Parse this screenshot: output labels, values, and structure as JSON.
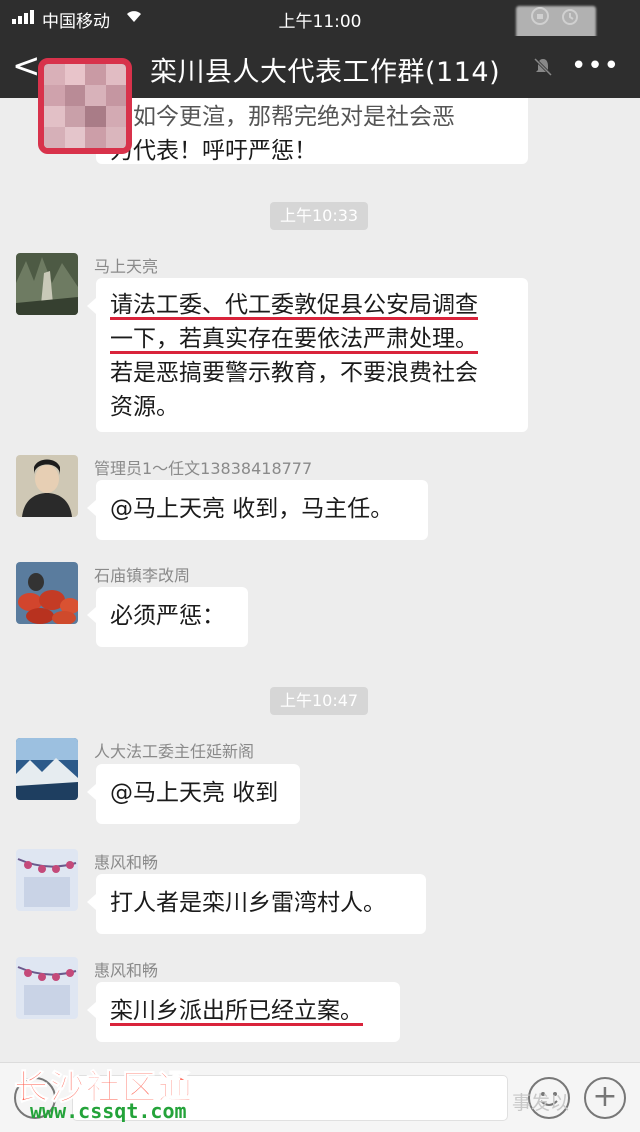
{
  "status_bar": {
    "carrier": "中国移动",
    "time": "上午11:00"
  },
  "nav": {
    "title": "栾川县人大代表工作群(114)"
  },
  "messages": {
    "m0": {
      "line1": "，如今更渲，那帮完绝对是社会恶",
      "line2": "力代表！呼吁严惩！"
    },
    "ts1": "上午10:33",
    "m1": {
      "sender": "马上天亮",
      "line1": "请法工委、代工委敦促县公安局调查",
      "line2": "一下，若真实存在要依法严肃处理。",
      "line3": "若是恶搞要警示教育，不要浪费社会",
      "line4": "资源。"
    },
    "m2": {
      "sender": "管理员1～任文13838418777",
      "text": "@马上天亮 收到，马主任。"
    },
    "m3": {
      "sender": "石庙镇李改周",
      "text": "必须严惩："
    },
    "ts2": "上午10:47",
    "m4": {
      "sender": "人大法工委主任延新阁",
      "text": "@马上天亮 收到"
    },
    "m5": {
      "sender": "惠风和畅",
      "text": "打人者是栾川乡雷湾村人。"
    },
    "m6": {
      "sender": "惠风和畅",
      "text": "栾川乡派出所已经立案。"
    }
  },
  "watermark": {
    "title": "长沙社区通",
    "url": "www.cssqt.com",
    "right": "事发以"
  },
  "colors": {
    "bar": "#2e2e2e",
    "chat_bg": "#ededed",
    "underline": "#d9233b",
    "mosaic_border": "#d8324b"
  }
}
